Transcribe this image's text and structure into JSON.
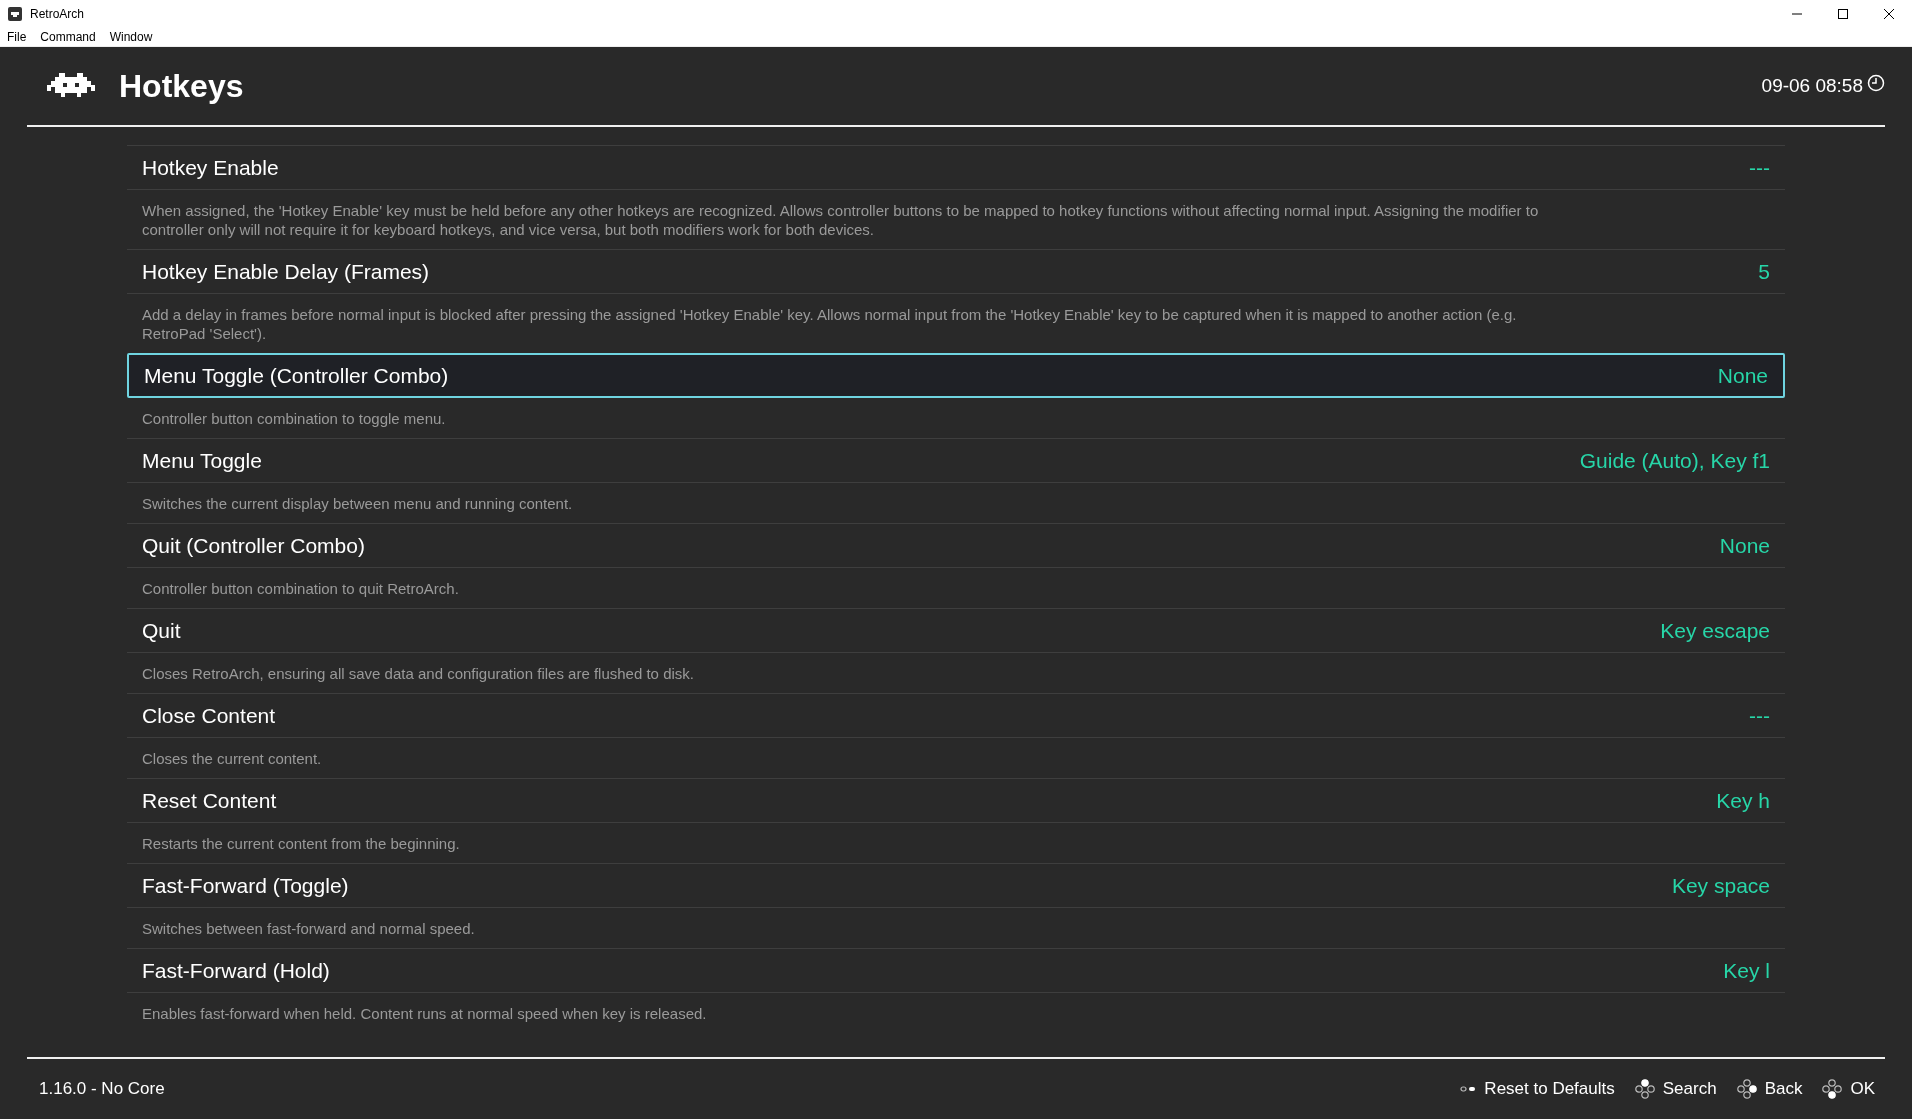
{
  "window": {
    "title": "RetroArch"
  },
  "menu": [
    "File",
    "Command",
    "Window"
  ],
  "header": {
    "title": "Hotkeys",
    "clock": "09-06 08:58"
  },
  "items": [
    {
      "label": "Hotkey Enable",
      "value": "---",
      "description": "When assigned, the 'Hotkey Enable' key must be held before any other hotkeys are recognized. Allows controller buttons to be mapped to hotkey functions without affecting normal input. Assigning the modifier to controller only will not require it for keyboard hotkeys, and vice versa, but both modifiers work for both devices.",
      "selected": false
    },
    {
      "label": "Hotkey Enable Delay (Frames)",
      "value": "5",
      "description": "Add a delay in frames before normal input is blocked after pressing the assigned 'Hotkey Enable' key. Allows normal input from the 'Hotkey Enable' key to be captured when it is mapped to another action (e.g. RetroPad 'Select').",
      "selected": false
    },
    {
      "label": "Menu Toggle (Controller Combo)",
      "value": "None",
      "description": "Controller button combination to toggle menu.",
      "selected": true
    },
    {
      "label": "Menu Toggle",
      "value": "Guide (Auto), Key f1",
      "description": "Switches the current display between menu and running content.",
      "selected": false
    },
    {
      "label": "Quit (Controller Combo)",
      "value": "None",
      "description": "Controller button combination to quit RetroArch.",
      "selected": false
    },
    {
      "label": "Quit",
      "value": "Key escape",
      "description": "Closes RetroArch, ensuring all save data and configuration files are flushed to disk.",
      "selected": false
    },
    {
      "label": "Close Content",
      "value": "---",
      "description": "Closes the current content.",
      "selected": false
    },
    {
      "label": "Reset Content",
      "value": "Key h",
      "description": "Restarts the current content from the beginning.",
      "selected": false
    },
    {
      "label": "Fast-Forward (Toggle)",
      "value": "Key space",
      "description": "Switches between fast-forward and normal speed.",
      "selected": false
    },
    {
      "label": "Fast-Forward (Hold)",
      "value": "Key l",
      "description": "Enables fast-forward when held. Content runs at normal speed when key is released.",
      "selected": false
    }
  ],
  "footer": {
    "version": "1.16.0 - No Core",
    "actions": [
      {
        "kind": "select",
        "label": "Reset to Defaults"
      },
      {
        "kind": "north",
        "label": "Search"
      },
      {
        "kind": "east",
        "label": "Back"
      },
      {
        "kind": "south",
        "label": "OK"
      }
    ]
  }
}
